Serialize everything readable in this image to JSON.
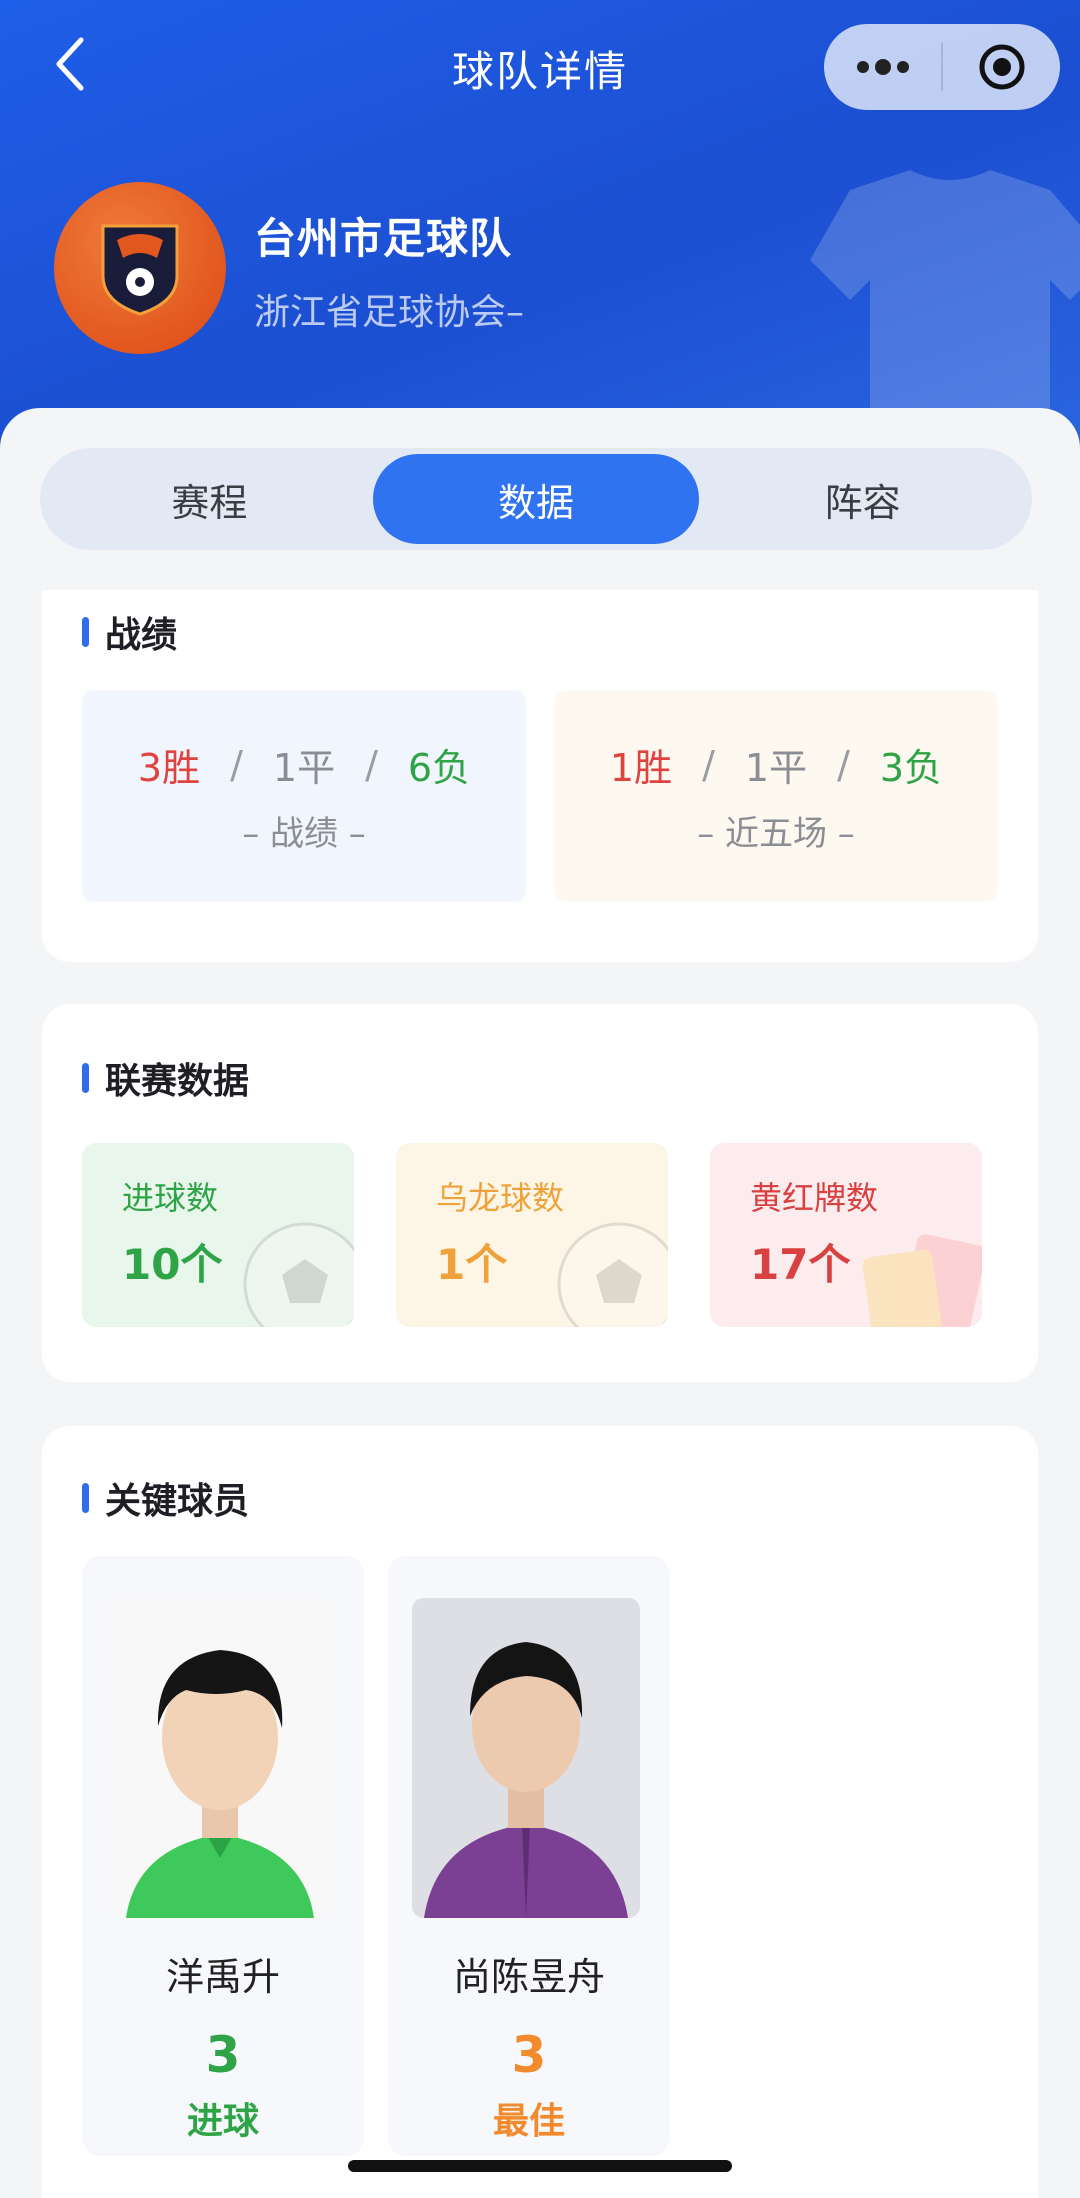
{
  "nav": {
    "title": "球队详情",
    "back_icon": "chevron-left-icon",
    "more_icon": "more-dots-icon",
    "close_icon": "target-icon"
  },
  "team": {
    "name": "台州市足球队",
    "association": "浙江省足球协会–"
  },
  "tabs": [
    {
      "label": "赛程",
      "active": false
    },
    {
      "label": "数据",
      "active": true
    },
    {
      "label": "阵容",
      "active": false
    }
  ],
  "record": {
    "title": "战绩",
    "overall": {
      "win": "3胜",
      "draw": "1平",
      "loss": "6负",
      "sep": "/",
      "caption": "– 战绩 –"
    },
    "recent": {
      "win": "1胜",
      "draw": "1平",
      "loss": "3负",
      "sep": "/",
      "caption": "– 近五场 –"
    }
  },
  "league": {
    "title": "联赛数据",
    "stats": [
      {
        "label": "进球数",
        "value": "10个",
        "color": "#2fa447",
        "bg": "#e9f6ec"
      },
      {
        "label": "乌龙球数",
        "value": "1个",
        "color": "#f0a23a",
        "bg": "#fdf5e6"
      },
      {
        "label": "黄红牌数",
        "value": "17个",
        "color": "#d94040",
        "bg": "#fdecee"
      }
    ]
  },
  "key_players": {
    "title": "关键球员",
    "players": [
      {
        "name": "洋禹升",
        "number": "3",
        "stat": "进球",
        "color": "#2fa447"
      },
      {
        "name": "尚陈昱舟",
        "number": "3",
        "stat": "最佳",
        "color": "#f28a2e"
      }
    ]
  },
  "colors": {
    "header": "#1f5ee8",
    "accent": "#2f73f0"
  }
}
